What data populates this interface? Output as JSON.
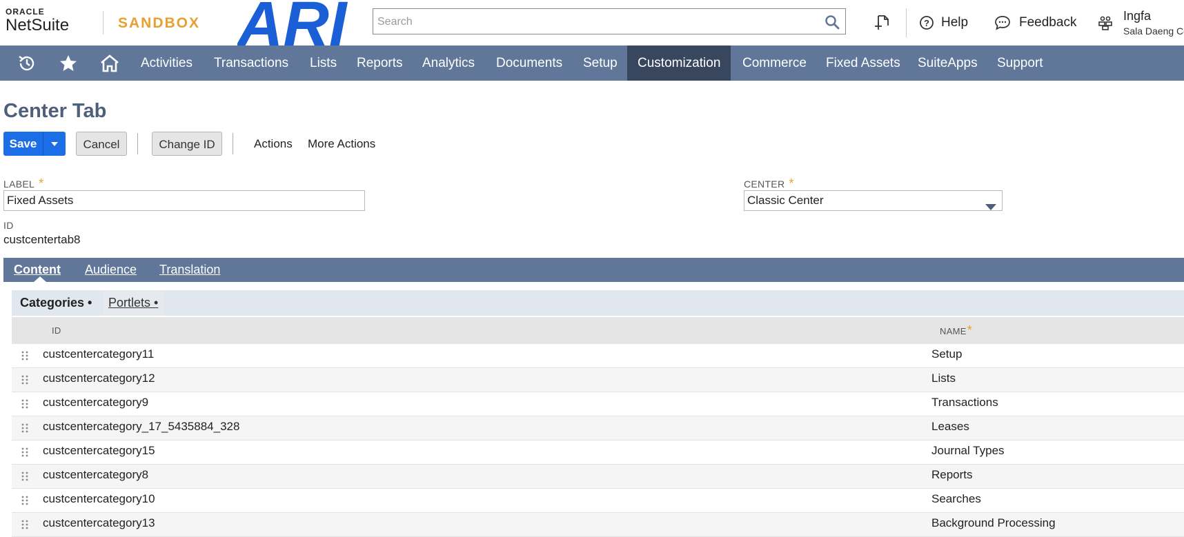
{
  "header": {
    "logo_oracle": "ORACLE",
    "logo_netsuite": "NetSuite",
    "environment": "SANDBOX",
    "brand_mark": "ARI",
    "search_placeholder": "Search",
    "help_label": "Help",
    "feedback_label": "Feedback",
    "user_name": "Ingfa",
    "user_subtitle": "Sala Daeng Co"
  },
  "nav": {
    "items": [
      "Activities",
      "Transactions",
      "Lists",
      "Reports",
      "Analytics",
      "Documents",
      "Setup",
      "Customization",
      "Commerce",
      "Fixed Assets",
      "SuiteApps",
      "Support"
    ],
    "active": "Customization"
  },
  "page": {
    "title": "Center Tab",
    "buttons": {
      "save": "Save",
      "cancel": "Cancel",
      "change_id": "Change ID",
      "actions": "Actions",
      "more_actions": "More Actions"
    },
    "fields": {
      "label_caption": "LABEL",
      "label_value": "Fixed Assets",
      "center_caption": "CENTER",
      "center_value": "Classic Center",
      "id_caption": "ID",
      "id_value": "custcentertab8",
      "required_mark": "*"
    }
  },
  "tabs": [
    "Content",
    "Audience",
    "Translation"
  ],
  "subtabs": [
    "Categories •",
    "Portlets •"
  ],
  "table": {
    "headers": {
      "id": "ID",
      "name": "NAME",
      "name_required": "*"
    },
    "rows": [
      {
        "id": "custcentercategory11",
        "name": "Setup"
      },
      {
        "id": "custcentercategory12",
        "name": "Lists"
      },
      {
        "id": "custcentercategory9",
        "name": "Transactions"
      },
      {
        "id": "custcentercategory_17_5435884_328",
        "name": "Leases"
      },
      {
        "id": "custcentercategory15",
        "name": "Journal Types"
      },
      {
        "id": "custcentercategory8",
        "name": "Reports"
      },
      {
        "id": "custcentercategory10",
        "name": "Searches"
      },
      {
        "id": "custcentercategory13",
        "name": "Background Processing"
      }
    ]
  },
  "colors": {
    "nav_bg": "#607799",
    "nav_active_bg": "#38475e",
    "primary_button": "#1b6ee6",
    "accent_orange": "#e8a032",
    "brand_blue": "#1a5fd6",
    "title_color": "#4d5f79"
  }
}
